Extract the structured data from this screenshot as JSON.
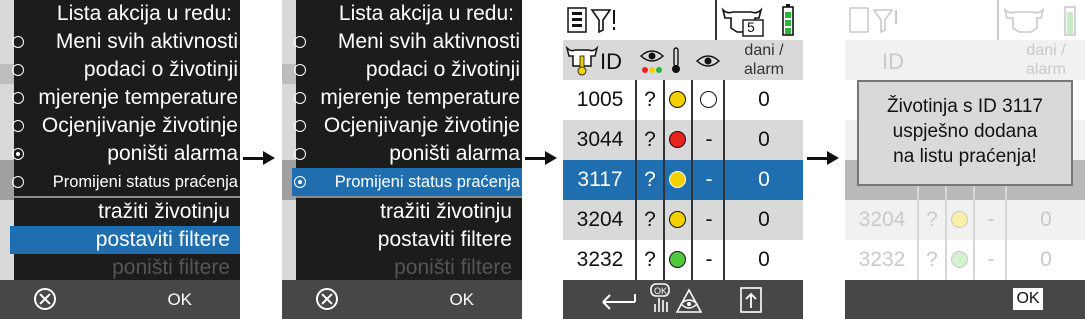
{
  "menu_title": "Lista akcija u redu:",
  "actions": [
    {
      "label": "Meni svih aktivnosti"
    },
    {
      "label": "podaci o životinji"
    },
    {
      "label": "mjerenje temperature"
    },
    {
      "label": "Ocjenjivanje životinje"
    },
    {
      "label": "poništi alarma"
    },
    {
      "label": "Promijeni status praćenja"
    }
  ],
  "functions": [
    {
      "label": "tražiti životinju"
    },
    {
      "label": "postaviti filtere"
    },
    {
      "label": "poništi filtere"
    }
  ],
  "softkeys": {
    "cancel_icon": "cancel-circle-icon",
    "ok": "OK"
  },
  "table": {
    "id_header": "ID",
    "days_header_1": "dani /",
    "days_header_2": "alarm",
    "battery_cow_count": "5",
    "rows": [
      {
        "id": "1005",
        "q": "?",
        "dot": "#f5d000",
        "state": "○",
        "days": "0"
      },
      {
        "id": "3044",
        "q": "?",
        "dot": "#e8231e",
        "state": "-",
        "days": "0"
      },
      {
        "id": "3117",
        "q": "?",
        "dot": "#f5d000",
        "state": "-",
        "days": "0"
      },
      {
        "id": "3204",
        "q": "?",
        "dot": "#f5d000",
        "state": "-",
        "days": "0"
      },
      {
        "id": "3232",
        "q": "?",
        "dot": "#4fc93d",
        "state": "-",
        "days": "0"
      }
    ]
  },
  "popup": {
    "line1": "Životinja s ID 3117",
    "line2": "uspješno dodana",
    "line3": "na listu praćenja!"
  },
  "colors": {
    "selected": "#1f6fb0",
    "dark": "#1c1c1c",
    "bar": "#474747",
    "header": "#d9d9d9"
  }
}
